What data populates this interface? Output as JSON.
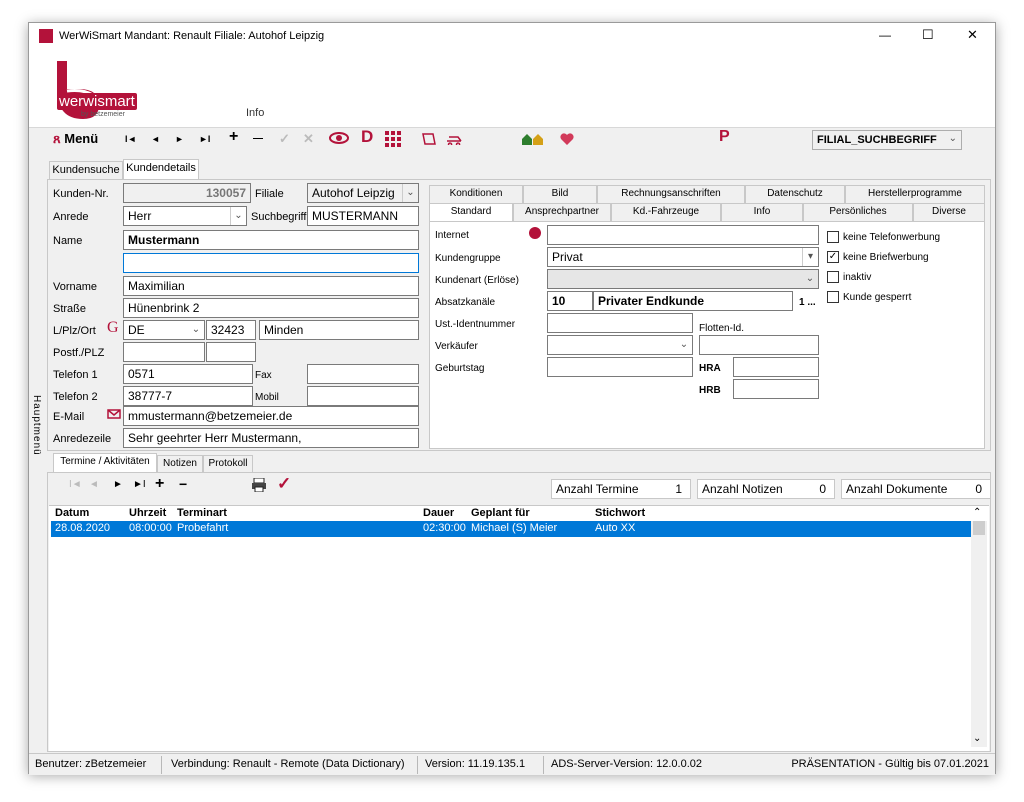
{
  "title_bar": {
    "title": "WerWiSmart  Mandant: Renault  Filiale: Autohof Leipzig",
    "minimize": "—",
    "maximize": "☐",
    "close": "✕"
  },
  "brand": {
    "name": "werwismart",
    "sub": "by betzemeier",
    "info": "Info"
  },
  "toolbar": {
    "menu_label": "Menü",
    "first": "I◄",
    "prev": "◄",
    "next": "►",
    "last": "►I",
    "add": "+",
    "remove": "—",
    "confirm": "✓",
    "cancel": "✕",
    "eye": "👁",
    "d_label": "D",
    "grid": "⠿",
    "p_label": "P",
    "search_select": "FILIAL_SUCHBEGRIFF"
  },
  "left_sidebar": {
    "label": "Hauptmenü"
  },
  "main_tabs": [
    "Kundensuche",
    "Kundendetails"
  ],
  "form": {
    "kundennr_label": "Kunden-Nr.",
    "kundennr": "130057",
    "filiale_label": "Filiale",
    "filiale": "Autohof Leipzig",
    "anrede_label": "Anrede",
    "anrede": "Herr",
    "suchbegriff_label": "Suchbegriff",
    "suchbegriff": "MUSTERMANN",
    "name_label": "Name",
    "name": "Mustermann",
    "name2": "",
    "vorname_label": "Vorname",
    "vorname": "Maximilian",
    "strasse_label": "Straße",
    "strasse": "Hünenbrink 2",
    "lplzort_label": "L/Plz/Ort",
    "land": "DE",
    "plz": "32423",
    "ort": "Minden",
    "postf_label": "Postf./PLZ",
    "postf": "",
    "postf_plz": "",
    "tel1_label": "Telefon 1",
    "tel1": "0571",
    "fax_label": "Fax",
    "fax": "",
    "tel2_label": "Telefon 2",
    "tel2": "38777-7",
    "mobil_label": "Mobil",
    "mobil": "",
    "email_label": "E-Mail",
    "email": "mmustermann@betzemeier.de",
    "anredezeile_label": "Anredezeile",
    "anredezeile": "Sehr geehrter Herr Mustermann,"
  },
  "right_tabs_row1": [
    "Konditionen",
    "Bild",
    "Rechnungsanschriften",
    "Datenschutz",
    "Herstellerprogramme"
  ],
  "right_tabs_row2": [
    "Standard",
    "Ansprechpartner",
    "Kd.-Fahrzeuge",
    "Info",
    "Persönliches",
    "Diverse"
  ],
  "standard": {
    "internet_label": "Internet",
    "internet": "",
    "kundengruppe_label": "Kundengruppe",
    "kundengruppe": "Privat",
    "kundenart_label": "Kundenart (Erlöse)",
    "kundenart": "",
    "absatzkanaele_label": "Absatzkanäle",
    "absatz_code": "10",
    "absatz_text": "Privater Endkunde",
    "absatz_more": "1 ...",
    "ustid_label": "Ust.-Identnummer",
    "ustid": "",
    "flotten_label": "Flotten-Id.",
    "flotten": "",
    "verkaeufer_label": "Verkäufer",
    "verkaeufer": "",
    "geburtstag_label": "Geburtstag",
    "geburtstag": "",
    "hra_label": "HRA",
    "hra": "",
    "hrb_label": "HRB",
    "hrb": ""
  },
  "checkboxes": [
    {
      "label": "keine Telefonwerbung",
      "checked": false
    },
    {
      "label": "keine Briefwerbung",
      "checked": true
    },
    {
      "label": "inaktiv",
      "checked": false
    },
    {
      "label": "Kunde gesperrt",
      "checked": false
    }
  ],
  "bottom_tabs": [
    "Termine / Aktivitäten",
    "Notizen",
    "Protokoll"
  ],
  "counters": {
    "termine_label": "Anzahl Termine",
    "termine": "1",
    "notizen_label": "Anzahl Notizen",
    "notizen": "0",
    "dokumente_label": "Anzahl Dokumente",
    "dokumente": "0"
  },
  "grid": {
    "headers": [
      "Datum",
      "Uhrzeit",
      "Terminart",
      "Dauer",
      "Geplant für",
      "Stichwort"
    ],
    "rows": [
      [
        "28.08.2020",
        "08:00:00",
        "Probefahrt",
        "02:30:00",
        "Michael (S) Meier",
        "Auto XX"
      ]
    ]
  },
  "status": {
    "user": "Benutzer: zBetzemeier",
    "connection": "Verbindung: Renault - Remote (Data Dictionary)",
    "version": "Version: 11.19.135.1",
    "ads": "ADS-Server-Version: 12.0.0.02",
    "presentation": "PRÄSENTATION - Gültig bis 07.01.2021"
  },
  "colors": {
    "accent": "#b3123a",
    "selection": "#0078d7"
  }
}
